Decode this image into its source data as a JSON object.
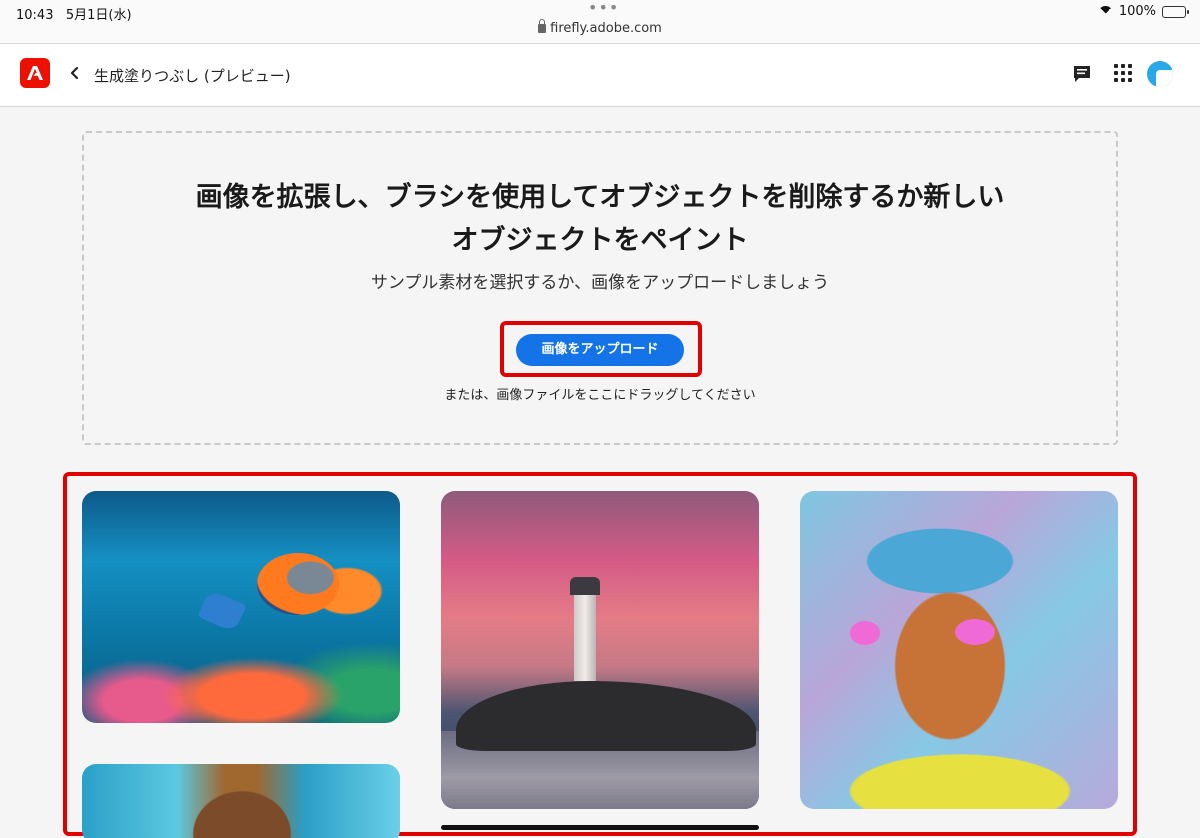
{
  "status_bar": {
    "time": "10:43",
    "date": "5月1日(水)",
    "url": "firefly.adobe.com",
    "battery": "100%",
    "battery_level": 1.0
  },
  "header": {
    "title": "生成塗りつぶし (プレビュー)"
  },
  "upload": {
    "heading_line1": "画像を拡張し、ブラシを使用してオブジェクトを削除するか新しい",
    "heading_line2": "オブジェクトをペイント",
    "subheading": "サンプル素材を選択するか、画像をアップロードしましょう",
    "button_label": "画像をアップロード",
    "drag_hint": "または、画像ファイルをここにドラッグしてください"
  },
  "gallery": {
    "items": [
      "sample-underwater-fish",
      "sample-lighthouse",
      "sample-portrait",
      "sample-bear"
    ]
  },
  "colors": {
    "accent": "#1473e6",
    "adobe_red": "#eb1000",
    "highlight": "#e00000"
  }
}
